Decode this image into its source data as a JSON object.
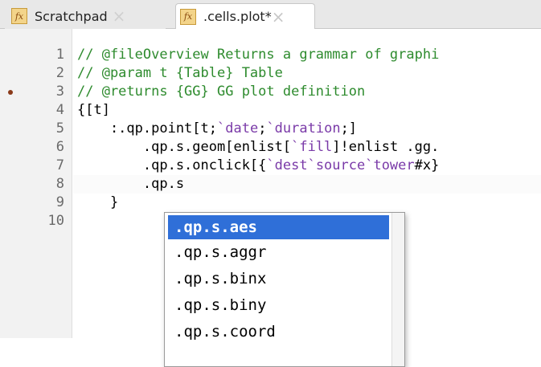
{
  "tabs": [
    {
      "label": "Scratchpad",
      "icon": "fx-icon",
      "close": "×",
      "active": false
    },
    {
      "label": ".cells.plot*",
      "icon": "fx-icon",
      "close": "×",
      "active": true
    }
  ],
  "fx_label": "fx",
  "editor": {
    "lines": [
      {
        "num": "1",
        "parts": [
          {
            "t": "// @fileOverview Returns a grammar of graphi",
            "c": "comment"
          }
        ]
      },
      {
        "num": "2",
        "parts": [
          {
            "t": "// @param t {Table} Table",
            "c": "comment"
          }
        ]
      },
      {
        "num": "3",
        "parts": [
          {
            "t": "// @returns {GG} GG plot definition",
            "c": "comment"
          }
        ],
        "marker": true
      },
      {
        "num": "4",
        "parts": [
          {
            "t": "{[t]",
            "c": ""
          }
        ]
      },
      {
        "num": "5",
        "parts": [
          {
            "t": "    :.qp.point[t;",
            "c": ""
          },
          {
            "t": "`date",
            "c": "sym"
          },
          {
            "t": ";",
            "c": ""
          },
          {
            "t": "`duration",
            "c": "sym"
          },
          {
            "t": ";]",
            "c": ""
          }
        ]
      },
      {
        "num": "6",
        "parts": [
          {
            "t": "        .qp.s.geom[enlist[",
            "c": ""
          },
          {
            "t": "`fill",
            "c": "sym"
          },
          {
            "t": "]!enlist .gg.",
            "c": ""
          }
        ]
      },
      {
        "num": "7",
        "parts": [
          {
            "t": "        .qp.s.onclick[{",
            "c": ""
          },
          {
            "t": "`dest`source`tower",
            "c": "sym"
          },
          {
            "t": "#x}",
            "c": ""
          }
        ]
      },
      {
        "num": "8",
        "parts": [
          {
            "t": "        .qp.s",
            "c": ""
          }
        ],
        "current": true
      },
      {
        "num": "9",
        "parts": [
          {
            "t": "    }",
            "c": ""
          }
        ]
      },
      {
        "num": "10",
        "parts": [
          {
            "t": "",
            "c": ""
          }
        ]
      }
    ]
  },
  "autocomplete": {
    "items": [
      ".qp.s.aes",
      ".qp.s.aggr",
      ".qp.s.binx",
      ".qp.s.biny",
      ".qp.s.coord"
    ],
    "selected_index": 0
  },
  "colors": {
    "comment": "#2e8b2e",
    "symbol": "#7a3aa8",
    "selection": "#2f6fd8",
    "fx_icon_bg": "#f3d48a"
  }
}
